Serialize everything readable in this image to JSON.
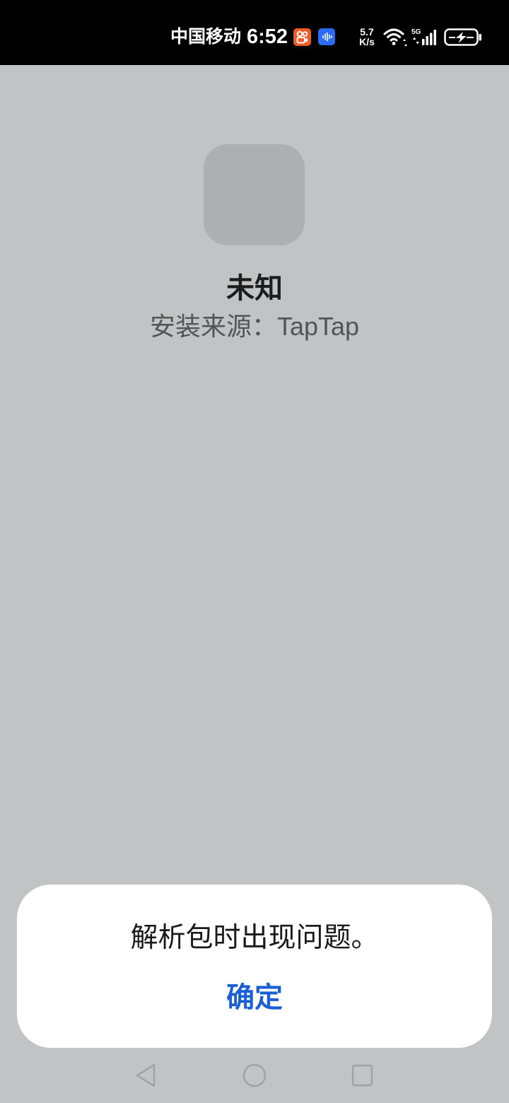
{
  "status_bar": {
    "carrier": "中国移动",
    "time": "6:52",
    "notification_icons": [
      "video-app-icon",
      "voice-app-icon"
    ],
    "net_speed": {
      "value": "5.7",
      "unit": "K/s"
    },
    "network_type": "5G",
    "wifi_icon": "wifi-icon",
    "signal_icon": "signal-bars-icon",
    "battery_icon": "battery-charging-icon"
  },
  "installer": {
    "app_icon": "app-icon-placeholder",
    "app_name": "未知",
    "install_source": "安装来源：TapTap"
  },
  "dialog": {
    "message": "解析包时出现问题。",
    "confirm_label": "确定"
  },
  "nav_bar": {
    "back_icon": "back-icon",
    "home_icon": "home-icon",
    "recents_icon": "recents-icon"
  },
  "colors": {
    "status_bar_bg": "#000000",
    "page_bg": "#c2c3c5",
    "dialog_bg": "#ffffff",
    "accent": "#1b5fd4",
    "icon_placeholder": "#aeafb1",
    "notification_orange": "#f05a23",
    "notification_blue": "#2a6cf6"
  }
}
